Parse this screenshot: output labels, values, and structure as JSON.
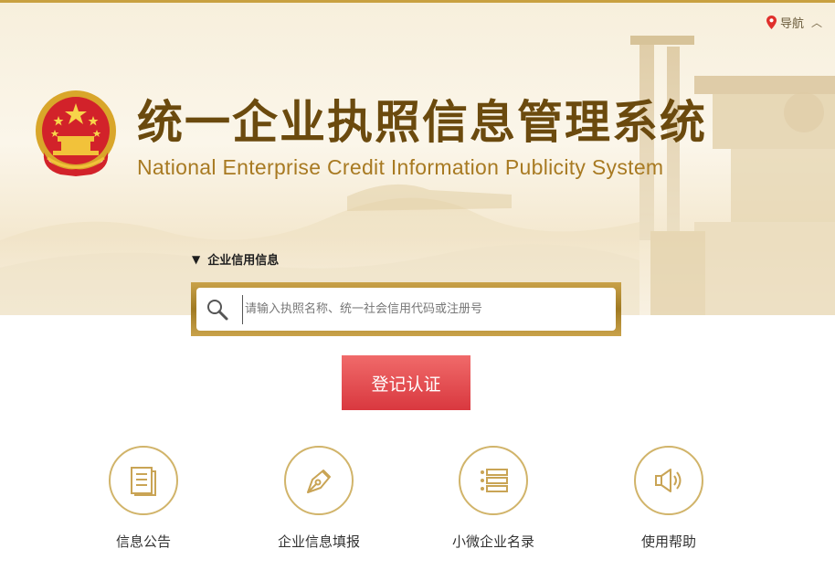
{
  "header": {
    "nav_label": "导航",
    "title_cn": "统一企业执照信息管理系统",
    "title_en": "National Enterprise Credit Information Publicity System"
  },
  "search": {
    "section_label": "企业信用信息",
    "placeholder": "请输入执照名称、统一社会信用代码或注册号",
    "value": ""
  },
  "register_button": "登记认证",
  "tiles": [
    {
      "label": "信息公告",
      "icon": "document-icon"
    },
    {
      "label": "企业信息填报",
      "icon": "pen-nib-icon"
    },
    {
      "label": "小微企业名录",
      "icon": "list-icon"
    },
    {
      "label": "使用帮助",
      "icon": "speaker-icon"
    }
  ],
  "colors": {
    "accent_gold": "#c8a040",
    "title_brown": "#6b4a0e",
    "button_red": "#e04a4f"
  }
}
